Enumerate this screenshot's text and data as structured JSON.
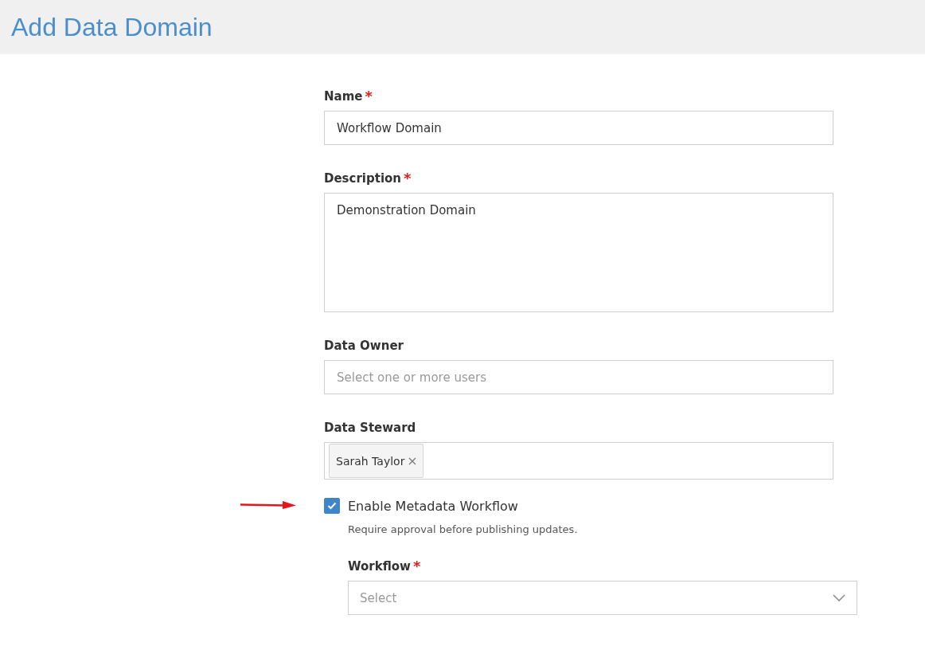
{
  "header": {
    "title": "Add Data Domain"
  },
  "required_mark": "*",
  "fields": [
    {
      "kind": "text",
      "label": "Name",
      "required": true,
      "value": "Workflow Domain"
    },
    {
      "kind": "textarea",
      "label": "Description",
      "required": true,
      "value": "Demonstration Domain"
    },
    {
      "kind": "users",
      "label": "Data Owner",
      "required": false,
      "placeholder": "Select one or more users"
    },
    {
      "kind": "users",
      "label": "Data Steward",
      "required": false,
      "tags": [
        "Sarah Taylor"
      ]
    }
  ],
  "workflow_toggle": {
    "label": "Enable Metadata Workflow",
    "checked": true,
    "hint": "Require approval before publishing updates."
  },
  "workflow": {
    "label": "Workflow",
    "required": true,
    "placeholder": "Select"
  }
}
